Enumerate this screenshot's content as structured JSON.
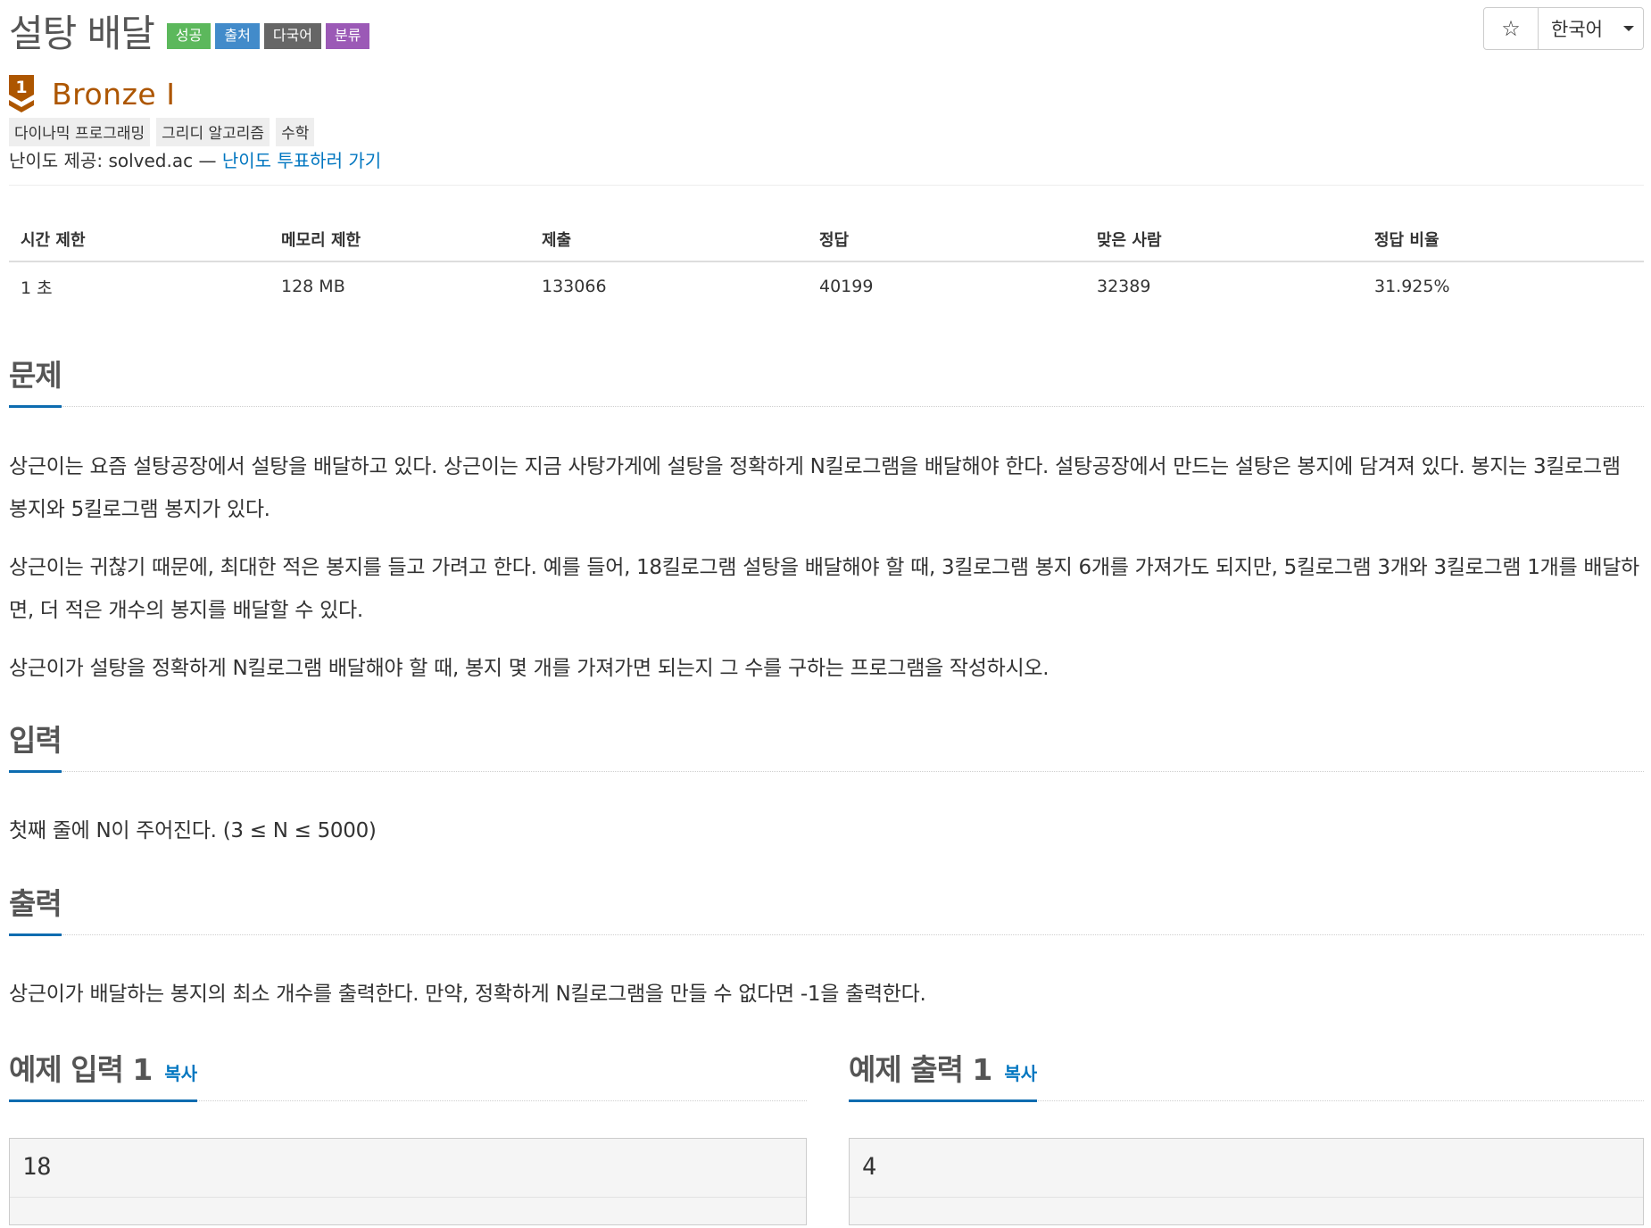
{
  "problem": {
    "title": "설탕 배달",
    "labels": [
      {
        "text": "성공",
        "color": "#5cb85c"
      },
      {
        "text": "출처",
        "color": "#428bca"
      },
      {
        "text": "다국어",
        "color": "#666666"
      },
      {
        "text": "분류",
        "color": "#9b59b6"
      }
    ]
  },
  "toolbar": {
    "star_symbol": "☆",
    "language": "한국어"
  },
  "tier": {
    "badge_number": "1",
    "name": "Bronze I",
    "color": "#ad5600"
  },
  "tags": [
    "다이나믹 프로그래밍",
    "그리디 알고리즘",
    "수학"
  ],
  "credit": {
    "prefix": "난이도 제공: solved.ac — ",
    "link": "난이도 투표하러 가기"
  },
  "stats": {
    "headers": [
      "시간 제한",
      "메모리 제한",
      "제출",
      "정답",
      "맞은 사람",
      "정답 비율"
    ],
    "values": [
      "1 초",
      "128 MB",
      "133066",
      "40199",
      "32389",
      "31.925%"
    ]
  },
  "sections": {
    "problem": {
      "title": "문제",
      "paragraphs": [
        "상근이는 요즘 설탕공장에서 설탕을 배달하고 있다. 상근이는 지금 사탕가게에 설탕을 정확하게 N킬로그램을 배달해야 한다. 설탕공장에서 만드는 설탕은 봉지에 담겨져 있다. 봉지는 3킬로그램 봉지와 5킬로그램 봉지가 있다.",
        "상근이는 귀찮기 때문에, 최대한 적은 봉지를 들고 가려고 한다. 예를 들어, 18킬로그램 설탕을 배달해야 할 때, 3킬로그램 봉지 6개를 가져가도 되지만, 5킬로그램 3개와 3킬로그램 1개를 배달하면, 더 적은 개수의 봉지를 배달할 수 있다.",
        "상근이가 설탕을 정확하게 N킬로그램 배달해야 할 때, 봉지 몇 개를 가져가면 되는지 그 수를 구하는 프로그램을 작성하시오."
      ]
    },
    "input": {
      "title": "입력",
      "text": "첫째 줄에 N이 주어진다. (3 ≤ N ≤ 5000)"
    },
    "output": {
      "title": "출력",
      "text": "상근이가 배달하는 봉지의 최소 개수를 출력한다. 만약, 정확하게 N킬로그램을 만들 수 없다면 -1을 출력한다."
    }
  },
  "samples": {
    "input": {
      "title": "예제 입력 1",
      "copy": "복사",
      "value": "18"
    },
    "output": {
      "title": "예제 출력 1",
      "copy": "복사",
      "value": "4"
    }
  }
}
